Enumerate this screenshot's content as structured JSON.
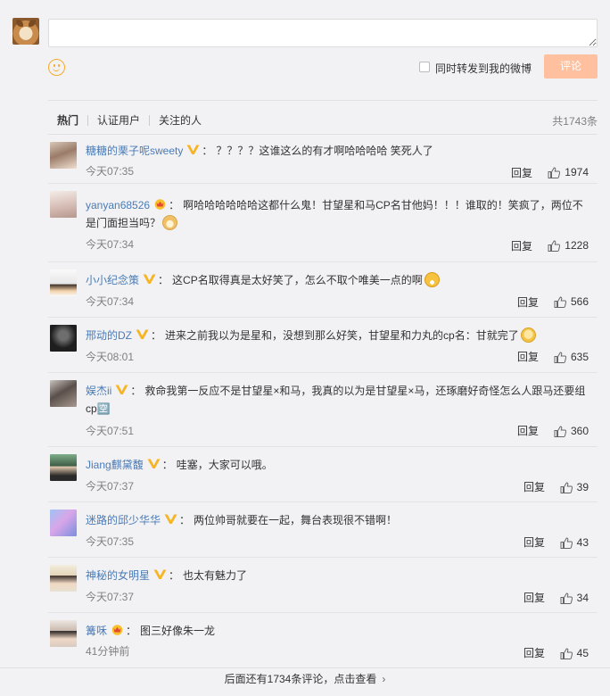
{
  "composer": {
    "input_value": "",
    "emoji_icon": "smiley-icon",
    "repost_label": "同时转发到我的微博",
    "submit_label": "评论",
    "submit_color": "#ffc09f"
  },
  "tabs": {
    "items": [
      "热门",
      "认证用户",
      "关注的人"
    ],
    "active": "热门",
    "total": "共1743条"
  },
  "comments": [
    {
      "user": "糖糖的栗子呢sweety",
      "badge": "v-badge-icon",
      "text": "？？？？这谁这么的有才啊哈哈哈哈 笑死人了",
      "time": "今天07:35",
      "reply": "回复",
      "likes": "1974"
    },
    {
      "user": "yanyan68526",
      "badge": "crown-badge-icon",
      "text": "啊哈哈哈哈哈哈这都什么鬼！甘望星和马CP名甘他妈！！！谁取的！笑疯了，两位不是门面担当吗？",
      "emoji": "doge-emoji-icon",
      "time": "今天07:34",
      "reply": "回复",
      "likes": "1228"
    },
    {
      "user": "小小纪念策",
      "badge": "v-badge-icon",
      "text": "这CP名取得真是太好笑了，怎么不取个唯美一点的啊",
      "emoji": "laugh-tears-emoji-icon",
      "time": "今天07:34",
      "reply": "回复",
      "likes": "566"
    },
    {
      "user": "邢动的DZ",
      "badge": "v-badge-icon",
      "text": "进来之前我以为是星和，没想到那么好笑，甘望星和力丸的cp名：甘就完了",
      "emoji": "thinking-emoji-icon",
      "time": "今天08:01",
      "reply": "回复",
      "likes": "635"
    },
    {
      "user": "娱杰ii",
      "badge": "v-badge-icon",
      "text": "救命我第一反应不是甘望星×和马，我真的以为是甘望星×马，还琢磨好奇怪怎么人跟马还要组cp🈳",
      "time": "今天07:51",
      "reply": "回复",
      "likes": "360"
    },
    {
      "user": "Jiang麒黛馥",
      "badge": "v-badge-icon",
      "text": "哇塞，大家可以哦。",
      "time": "今天07:37",
      "reply": "回复",
      "likes": "39"
    },
    {
      "user": "迷路的邱少华华",
      "badge": "v-badge-icon",
      "text": "两位帅哥就要在一起，舞台表现很不错啊！",
      "time": "今天07:35",
      "reply": "回复",
      "likes": "43"
    },
    {
      "user": "神秘的女明星",
      "badge": "v-badge-icon",
      "text": "也太有魅力了",
      "time": "今天07:37",
      "reply": "回复",
      "likes": "34"
    },
    {
      "user": "篝咊",
      "badge": "crown-badge-icon",
      "text": "图三好像朱一龙",
      "time": "41分钟前",
      "reply": "回复",
      "likes": "45"
    }
  ],
  "footer": {
    "more_label": "后面还有1734条评论，点击查看"
  }
}
